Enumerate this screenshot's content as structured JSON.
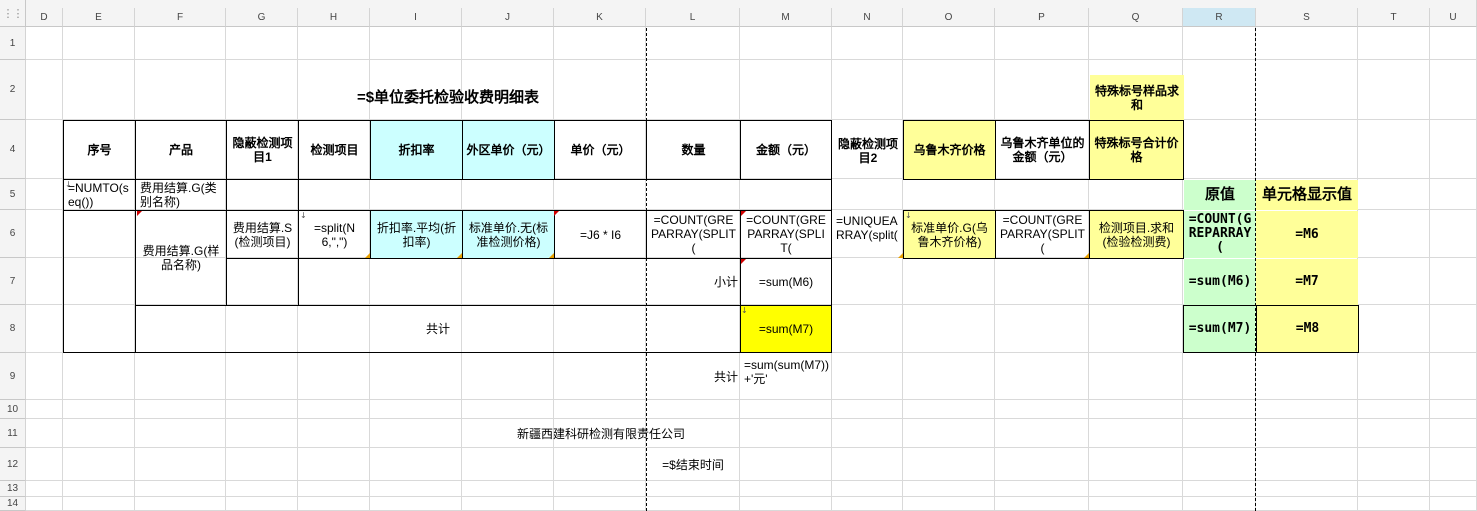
{
  "colors": {
    "cyan": "#ccffff",
    "light_yellow": "#ffff99",
    "bright_yellow": "#ffff00",
    "light_green": "#ccffcc",
    "selected_header": "#cfe8f3"
  },
  "corner_label": "⋮⋮",
  "columns": [
    "D",
    "E",
    "F",
    "G",
    "H",
    "I",
    "J",
    "K",
    "L",
    "M",
    "N",
    "O",
    "P",
    "Q",
    "R",
    "S",
    "T",
    "U"
  ],
  "rows": [
    "1",
    "2",
    "4",
    "5",
    "6",
    "7",
    "8",
    "9",
    "10",
    "11",
    "12",
    "13",
    "14"
  ],
  "title": "=$单位委托检验收费明细表",
  "special_sum_title": "特殊标号样品求和",
  "headers": {
    "seq": "序号",
    "product": "产品",
    "hidden1": "隐蔽检测项目1",
    "item": "检测项目",
    "discount": "折扣率",
    "outer_price": "外区单价（元）",
    "unit_price": "单价（元）",
    "quantity": "数量",
    "amount": "金额（元）",
    "hidden2": "隐蔽检测项目2",
    "urumqi_price": "乌鲁木齐价格",
    "urumqi_amount": "乌鲁木齐单位的金额（元）",
    "special_total": "特殊标号合计价格"
  },
  "r5": {
    "numto": "=NUMTO(seq())",
    "category": "费用结算.G(类别名称)"
  },
  "r6": {
    "product": "费用结算.G(样品名称)",
    "hidden1": "费用结算.S(检测项目)",
    "split": "=split(N6,\",\")",
    "discount": "折扣率.平均(折扣率)",
    "std_price": "标准单价.无(标准检测价格)",
    "formula_k": "=J6 * I6",
    "count_l": "=COUNT(GREPARRAY(SPLIT(",
    "count_m": "=COUNT(GREPARRAY(SPLIT(",
    "uniq": "=UNIQUEARRAY(split(",
    "urumqi": "标准单价.G(乌鲁木齐价格)",
    "count_p": "=COUNT(GREPARRAY(SPLIT(",
    "sum_q": "检测项目.求和(检验检测费)"
  },
  "r7": {
    "subtotal": "小计",
    "sum": "=sum(M6)"
  },
  "r8": {
    "total": "共计",
    "sum": "=sum(M7)"
  },
  "r9": {
    "total": "共计",
    "formula": "=sum(sum(M7))+'元'"
  },
  "r11": {
    "company": "新疆西建科研检测有限责任公司"
  },
  "r12": {
    "end_time": "=$结束时间"
  },
  "side": {
    "orig_title": "原值",
    "display_title": "单元格显示值",
    "r6_orig": "=COUNT(GREPARRAY(",
    "r6_disp": "=M6",
    "r7_orig": "=sum(M6)",
    "r7_disp": "=M7",
    "r8_orig": "=sum(M7)",
    "r8_disp": "=M8"
  }
}
